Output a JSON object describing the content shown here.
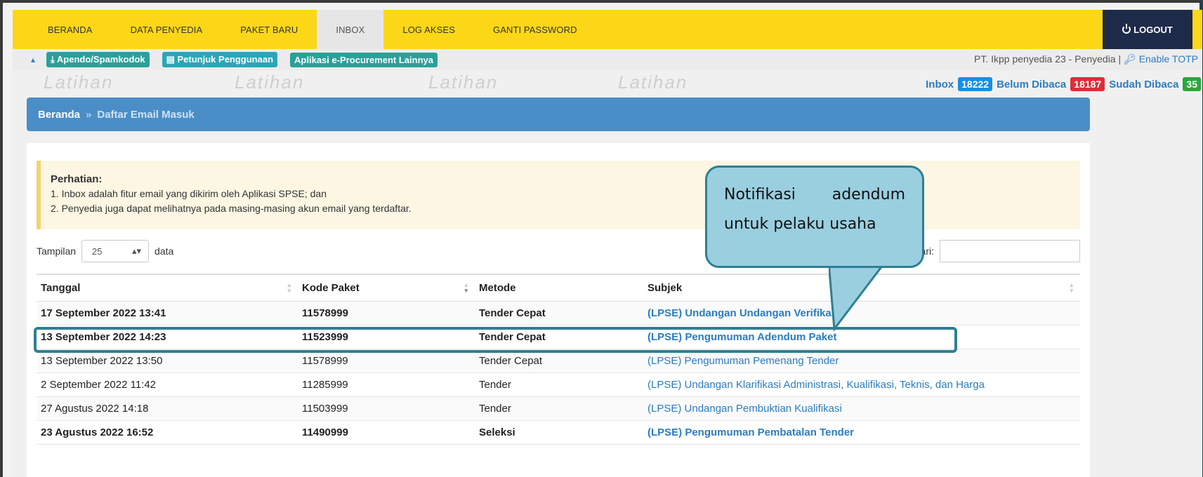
{
  "nav": {
    "items": [
      "BERANDA",
      "DATA PENYEDIA",
      "PAKET BARU",
      "INBOX",
      "LOG AKSES",
      "GANTI PASSWORD"
    ],
    "active": "INBOX",
    "logout": "LOGOUT"
  },
  "subbar": {
    "tags": [
      "Apendo/Spamkodok",
      "Petunjuk Penggunaan",
      "Aplikasi e-Procurement Lainnya"
    ],
    "user": "PT. Ikpp penyedia 23 - Penyedia |",
    "totp": "Enable TOTP"
  },
  "watermark": "Latihan",
  "counts": {
    "inbox_label": "Inbox",
    "inbox": "18222",
    "unread_label": "Belum Dibaca",
    "unread": "18187",
    "read_label": "Sudah Dibaca",
    "read": "35"
  },
  "breadcrumb": {
    "home": "Beranda",
    "sep": "»",
    "current": "Daftar Email Masuk"
  },
  "alert": {
    "title": "Perhatian:",
    "line1": "1. Inbox adalah fitur email yang dikirim oleh Aplikasi SPSE; dan",
    "line2": "2. Penyedia juga dapat melihatnya pada masing-masing akun email yang terdaftar."
  },
  "controls": {
    "tampilan": "Tampilan",
    "page_size": "25",
    "data": "data",
    "cari": "Cari:"
  },
  "table": {
    "headers": [
      "Tanggal",
      "Kode Paket",
      "Metode",
      "Subjek"
    ],
    "rows": [
      {
        "tanggal": "17 September 2022 13:41",
        "kode": "11578999",
        "metode": "Tender Cepat",
        "subjek": "(LPSE) Undangan Undangan Verifikasi",
        "bold": true
      },
      {
        "tanggal": "13 September 2022 14:23",
        "kode": "11523999",
        "metode": "Tender Cepat",
        "subjek": "(LPSE) Pengumuman Adendum Paket",
        "bold": true
      },
      {
        "tanggal": "13 September 2022 13:50",
        "kode": "11578999",
        "metode": "Tender Cepat",
        "subjek": "(LPSE) Pengumuman Pemenang Tender",
        "bold": false
      },
      {
        "tanggal": "2 September 2022 11:42",
        "kode": "11285999",
        "metode": "Tender",
        "subjek": "(LPSE) Undangan Klarifikasi Administrasi, Kualifikasi, Teknis, dan Harga",
        "bold": false
      },
      {
        "tanggal": "27 Agustus 2022 14:18",
        "kode": "11503999",
        "metode": "Tender",
        "subjek": "(LPSE) Undangan Pembuktian Kualifikasi",
        "bold": false
      },
      {
        "tanggal": "23 Agustus 2022 16:52",
        "kode": "11490999",
        "metode": "Seleksi",
        "subjek": "(LPSE) Pengumuman Pembatalan Tender",
        "bold": true
      }
    ]
  },
  "callout": {
    "w1": "Notifikasi",
    "w2": "adendum",
    "line2": "untuk pelaku usaha"
  }
}
